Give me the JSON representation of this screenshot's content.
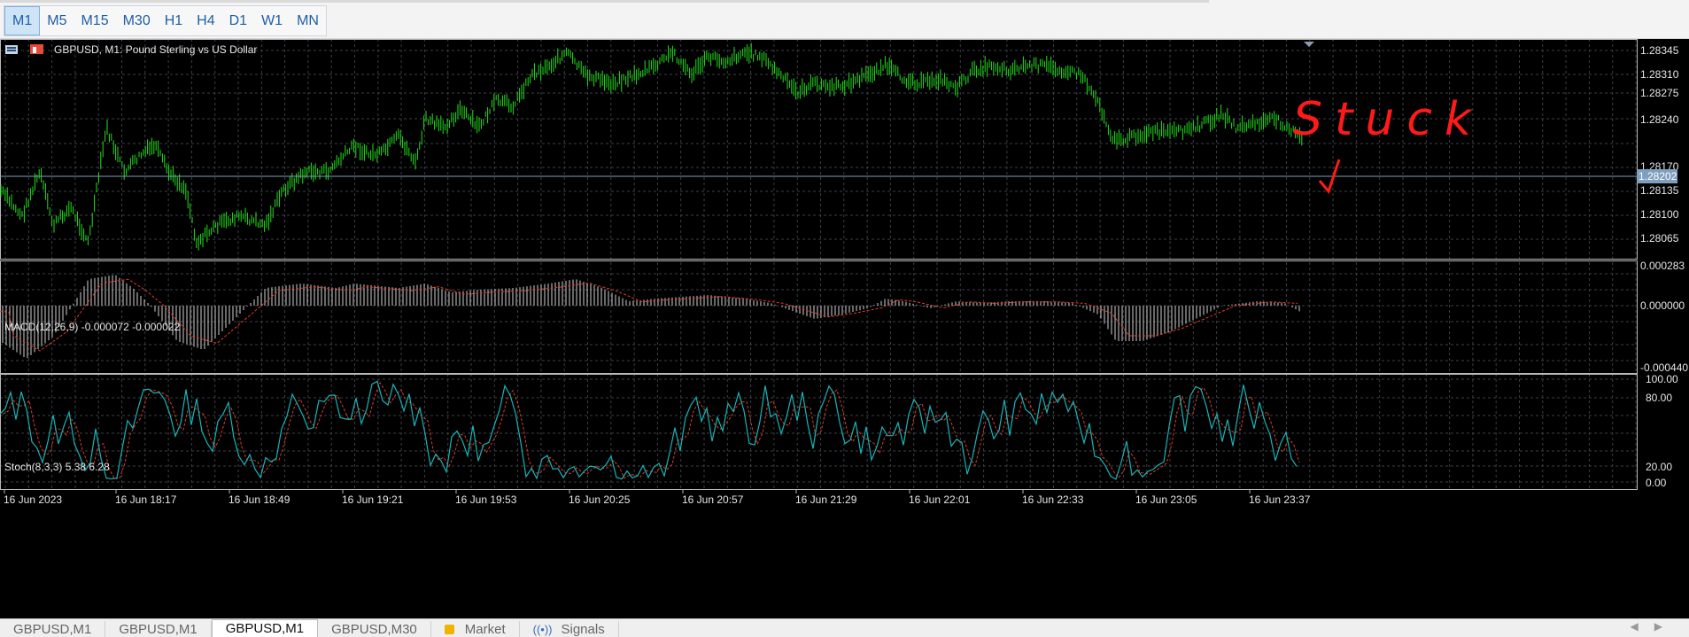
{
  "timeframes": [
    {
      "label": "M1",
      "active": true
    },
    {
      "label": "M5",
      "active": false
    },
    {
      "label": "M15",
      "active": false
    },
    {
      "label": "M30",
      "active": false
    },
    {
      "label": "H1",
      "active": false
    },
    {
      "label": "H4",
      "active": false
    },
    {
      "label": "D1",
      "active": false
    },
    {
      "label": "W1",
      "active": false
    },
    {
      "label": "MN",
      "active": false
    }
  ],
  "chart": {
    "title": "GBPUSD, M1:  Pound Sterling vs US Dollar",
    "current_price": "1.28202",
    "price_labels": [
      "1.28345",
      "1.28310",
      "1.28275",
      "1.28240",
      "1.28170",
      "1.28135",
      "1.28100",
      "1.28065"
    ],
    "annotation": "Stuck",
    "macd_title": "MACD(12,26,9) -0.000072 -0.000022",
    "macd_labels": [
      "0.000283",
      "0.000000",
      "-0.000440"
    ],
    "stoch_title": "Stoch(8,3,3) 5.38 6.28",
    "stoch_labels": [
      "100.00",
      "80.00",
      "20.00",
      "0.00"
    ],
    "time_labels": [
      "16 Jun 2023",
      "16 Jun 18:17",
      "16 Jun 18:49",
      "16 Jun 19:21",
      "16 Jun 19:53",
      "16 Jun 20:25",
      "16 Jun 20:57",
      "16 Jun 21:29",
      "16 Jun 22:01",
      "16 Jun 22:33",
      "16 Jun 23:05",
      "16 Jun 23:37"
    ]
  },
  "colors": {
    "candle": "#22e01a",
    "grid": "#3a3f47",
    "signal": "#e23b2a",
    "stoch_main": "#18b5b8",
    "price_line": "#7ea0bf",
    "annotation": "#ff1a1a"
  },
  "tabs": [
    {
      "label": "GBPUSD,M1",
      "active": false,
      "icon": ""
    },
    {
      "label": "GBPUSD,M1",
      "active": false,
      "icon": ""
    },
    {
      "label": "GBPUSD,M1",
      "active": true,
      "icon": ""
    },
    {
      "label": "GBPUSD,M30",
      "active": false,
      "icon": ""
    },
    {
      "label": "Market",
      "active": false,
      "icon": "lock-icon"
    },
    {
      "label": "Signals",
      "active": false,
      "icon": "signal-icon"
    }
  ]
}
